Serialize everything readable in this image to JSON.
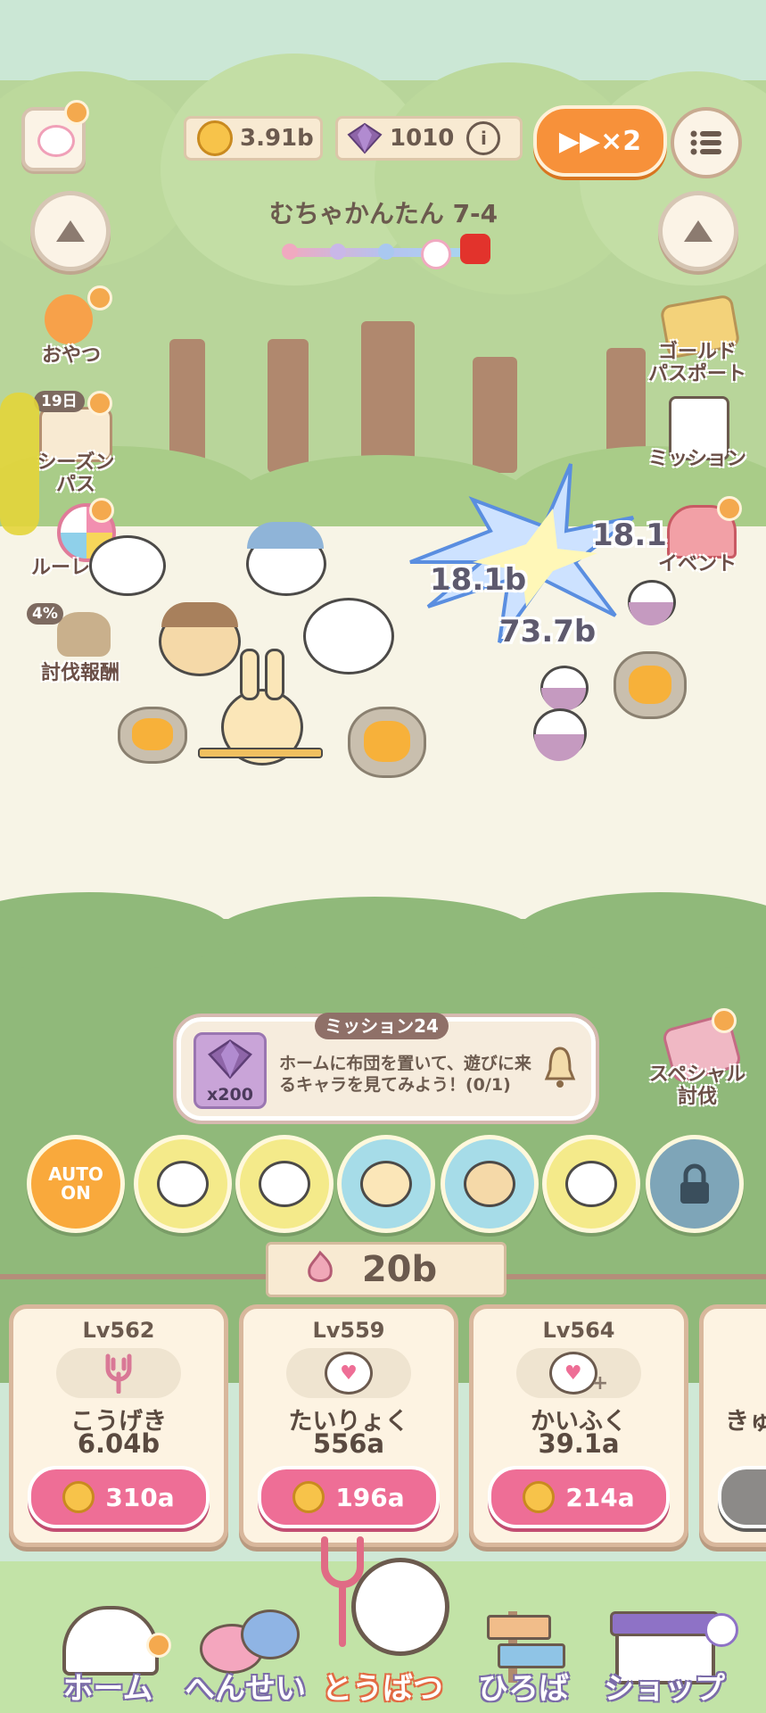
{
  "header": {
    "coins": "3.91b",
    "gems": "1010",
    "speed_label": "▶▶×2",
    "stage_title": "むちゃかんたん 7-4"
  },
  "left_menu": {
    "snack_label": "おやつ",
    "season_days_badge": "19日",
    "season_pass_label": "シーズン\nパス",
    "roulette_label": "ルーレット",
    "reward_percent": "4%",
    "subjugation_reward_label": "討伐報酬"
  },
  "right_menu": {
    "gold_passport_label": "ゴールド\nパスポート",
    "mission_label": "ミッション",
    "event_label": "イベント",
    "special_label": "スペシャル\n討伐"
  },
  "battle": {
    "damage_numbers": [
      "18.1",
      "18.1b",
      "73.7b"
    ]
  },
  "mission": {
    "title": "ミッション24",
    "reward_count": "x200",
    "description": "ホームに布団を置いて、遊びに来るキャラを見てみよう！(0/1)"
  },
  "skills": {
    "auto_label": "AUTO\nON"
  },
  "upgrade": {
    "power_value": "20b",
    "cards": [
      {
        "level": "Lv562",
        "name": "こうげき",
        "amount": "6.04b",
        "cost": "310a"
      },
      {
        "level": "Lv559",
        "name": "たいりょく",
        "amount": "556a",
        "cost": "196a"
      },
      {
        "level": "Lv564",
        "name": "かいふく",
        "amount": "39.1a",
        "cost": "214a"
      },
      {
        "name": "きゅ"
      }
    ]
  },
  "nav": {
    "items": [
      {
        "label": "ホーム"
      },
      {
        "label": "へんせい"
      },
      {
        "label": "とうばつ"
      },
      {
        "label": "ひろば"
      },
      {
        "label": "ショップ"
      }
    ]
  }
}
